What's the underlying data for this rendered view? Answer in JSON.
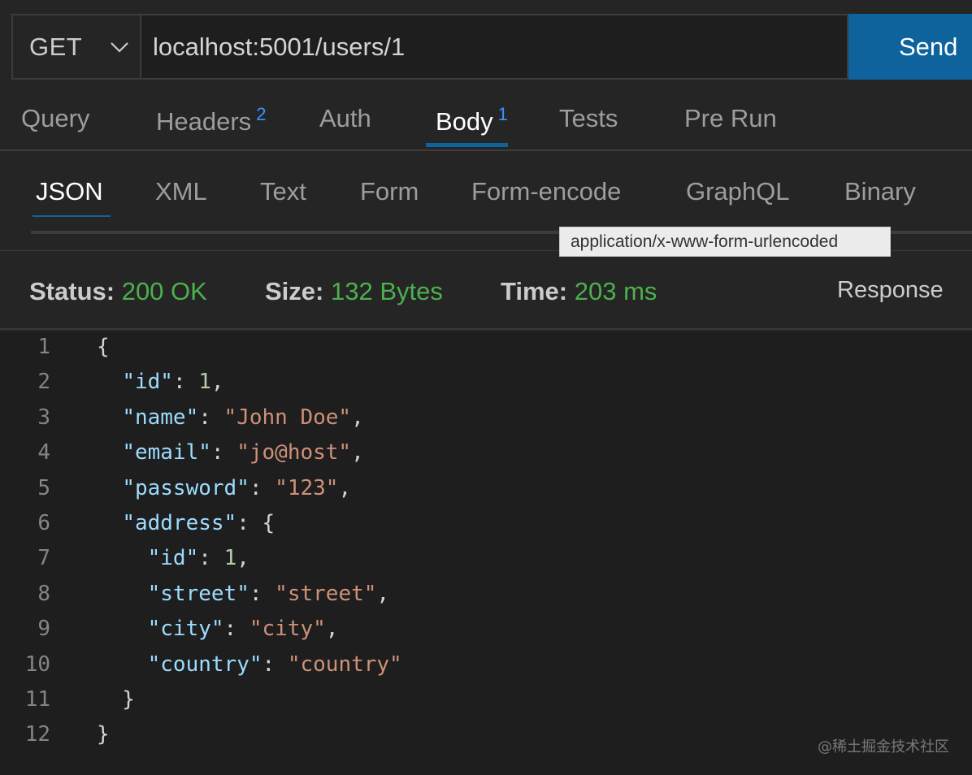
{
  "request": {
    "method": "GET",
    "url": "localhost:5001/users/1",
    "send_label": "Send"
  },
  "tabs": [
    {
      "label": "Query",
      "badge": ""
    },
    {
      "label": "Headers",
      "badge": "2"
    },
    {
      "label": "Auth",
      "badge": ""
    },
    {
      "label": "Body",
      "badge": "1"
    },
    {
      "label": "Tests",
      "badge": ""
    },
    {
      "label": "Pre Run",
      "badge": ""
    }
  ],
  "body_tabs": [
    "JSON",
    "XML",
    "Text",
    "Form",
    "Form-encode",
    "GraphQL",
    "Binary"
  ],
  "tooltip": "application/x-www-form-urlencoded",
  "status": {
    "status_label": "Status:",
    "status_value": "200 OK",
    "size_label": "Size:",
    "size_value": "132 Bytes",
    "time_label": "Time:",
    "time_value": "203 ms",
    "response_label": "Response"
  },
  "editor": {
    "line_numbers": [
      "1",
      "2",
      "3",
      "4",
      "5",
      "6",
      "7",
      "8",
      "9",
      "10",
      "11",
      "12"
    ],
    "lines": [
      [
        {
          "t": "{",
          "c": "p"
        }
      ],
      [
        {
          "t": "  ",
          "c": "p"
        },
        {
          "t": "\"id\"",
          "c": "k"
        },
        {
          "t": ": ",
          "c": "p"
        },
        {
          "t": "1",
          "c": "n"
        },
        {
          "t": ",",
          "c": "p"
        }
      ],
      [
        {
          "t": "  ",
          "c": "p"
        },
        {
          "t": "\"name\"",
          "c": "k"
        },
        {
          "t": ": ",
          "c": "p"
        },
        {
          "t": "\"John Doe\"",
          "c": "s"
        },
        {
          "t": ",",
          "c": "p"
        }
      ],
      [
        {
          "t": "  ",
          "c": "p"
        },
        {
          "t": "\"email\"",
          "c": "k"
        },
        {
          "t": ": ",
          "c": "p"
        },
        {
          "t": "\"jo@host\"",
          "c": "s"
        },
        {
          "t": ",",
          "c": "p"
        }
      ],
      [
        {
          "t": "  ",
          "c": "p"
        },
        {
          "t": "\"password\"",
          "c": "k"
        },
        {
          "t": ": ",
          "c": "p"
        },
        {
          "t": "\"123\"",
          "c": "s"
        },
        {
          "t": ",",
          "c": "p"
        }
      ],
      [
        {
          "t": "  ",
          "c": "p"
        },
        {
          "t": "\"address\"",
          "c": "k"
        },
        {
          "t": ": {",
          "c": "p"
        }
      ],
      [
        {
          "t": "    ",
          "c": "p"
        },
        {
          "t": "\"id\"",
          "c": "k"
        },
        {
          "t": ": ",
          "c": "p"
        },
        {
          "t": "1",
          "c": "n"
        },
        {
          "t": ",",
          "c": "p"
        }
      ],
      [
        {
          "t": "    ",
          "c": "p"
        },
        {
          "t": "\"street\"",
          "c": "k"
        },
        {
          "t": ": ",
          "c": "p"
        },
        {
          "t": "\"street\"",
          "c": "s"
        },
        {
          "t": ",",
          "c": "p"
        }
      ],
      [
        {
          "t": "    ",
          "c": "p"
        },
        {
          "t": "\"city\"",
          "c": "k"
        },
        {
          "t": ": ",
          "c": "p"
        },
        {
          "t": "\"city\"",
          "c": "s"
        },
        {
          "t": ",",
          "c": "p"
        }
      ],
      [
        {
          "t": "    ",
          "c": "p"
        },
        {
          "t": "\"country\"",
          "c": "k"
        },
        {
          "t": ": ",
          "c": "p"
        },
        {
          "t": "\"country\"",
          "c": "s"
        }
      ],
      [
        {
          "t": "  }",
          "c": "p"
        }
      ],
      [
        {
          "t": "}",
          "c": "p"
        }
      ]
    ]
  },
  "watermark": "@稀土掘金技术社区",
  "colors": {
    "accent": "#0e639c",
    "badge": "#3794ff",
    "status_ok": "#4cb04c",
    "json_key": "#9cdcfe",
    "json_string": "#ce9178",
    "json_number": "#b5cea8"
  }
}
